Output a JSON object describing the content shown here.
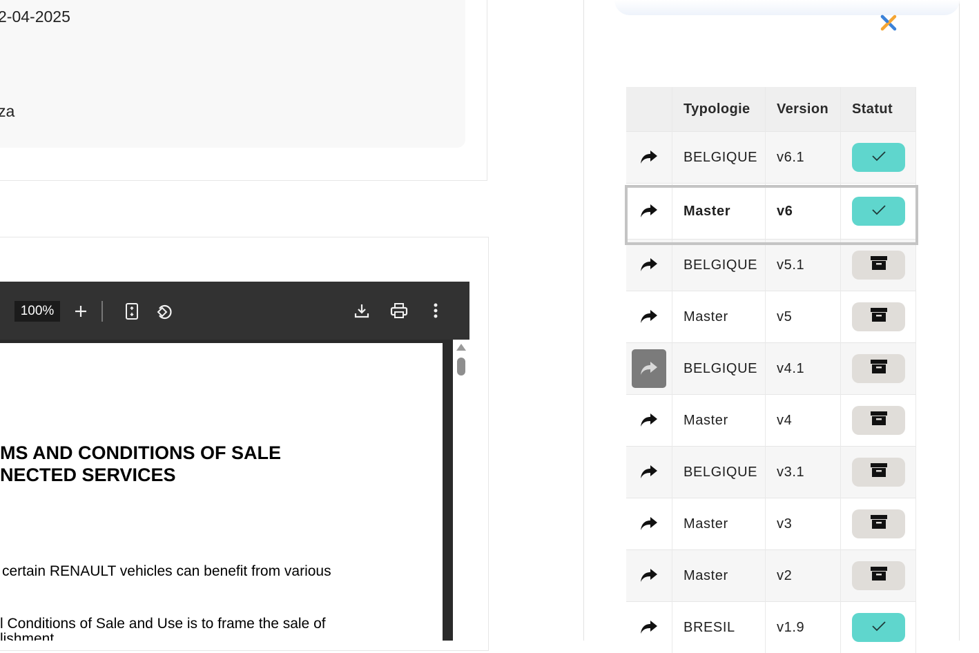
{
  "top_card": {
    "date": "2-04-2025",
    "name_fragment": "za"
  },
  "pdf_viewer": {
    "zoom": "100%",
    "heading_line1": "MS AND CONDITIONS OF SALE",
    "heading_line2": "NECTED SERVICES",
    "body_line1": "certain RENAULT vehicles can benefit from various",
    "body_line2": "l Conditions of Sale and Use is to frame the sale of",
    "body_line3": "lishment"
  },
  "versions_table": {
    "headers": {
      "action": "",
      "typology": "Typologie",
      "version": "Version",
      "status": "Statut"
    },
    "rows": [
      {
        "typology": "BELGIQUE",
        "version": "v6.1",
        "status": "check"
      },
      {
        "typology": "Master",
        "version": "v6",
        "status": "check"
      },
      {
        "typology": "BELGIQUE",
        "version": "v5.1",
        "status": "archive"
      },
      {
        "typology": "Master",
        "version": "v5",
        "status": "archive"
      },
      {
        "typology": "BELGIQUE",
        "version": "v4.1",
        "status": "archive"
      },
      {
        "typology": "Master",
        "version": "v4",
        "status": "archive"
      },
      {
        "typology": "BELGIQUE",
        "version": "v3.1",
        "status": "archive"
      },
      {
        "typology": "Master",
        "version": "v3",
        "status": "archive"
      },
      {
        "typology": "Master",
        "version": "v2",
        "status": "archive"
      },
      {
        "typology": "BRESIL",
        "version": "v1.9",
        "status": "check"
      }
    ],
    "selected_row": 1,
    "hovered_action_row": 4
  },
  "icons": {
    "close": "close-x-icon",
    "row_action": "share-forward-arrow-icon",
    "status_ok": "check-icon",
    "status_archived": "archive-box-icon"
  },
  "colors": {
    "status_ok_bg": "#5fd6cd",
    "status_archived_bg": "#e0ddd9",
    "toolbar_bg": "#323232",
    "close_blue": "#3b82d9",
    "close_orange": "#f4a533"
  }
}
